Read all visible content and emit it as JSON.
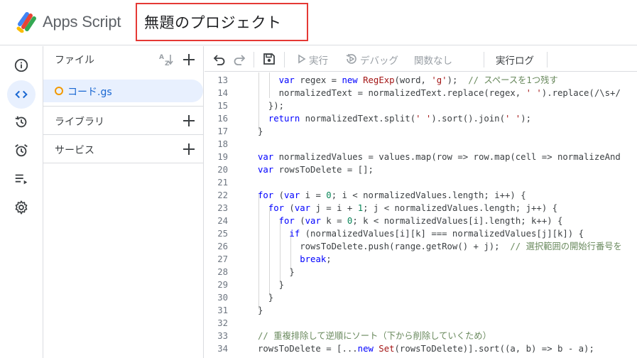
{
  "header": {
    "app_name": "Apps Script",
    "project_title": "無題のプロジェクト"
  },
  "rail": {
    "items": [
      "info-icon",
      "code-icon",
      "history-icon",
      "alarm-icon",
      "executions-icon",
      "settings-icon"
    ],
    "active": "code-icon"
  },
  "files": {
    "label": "ファイル",
    "file_name": "コード.gs",
    "libraries_label": "ライブラリ",
    "services_label": "サービス"
  },
  "toolbar": {
    "run_label": "実行",
    "debug_label": "デバッグ",
    "function_label": "関数なし",
    "log_label": "実行ログ"
  },
  "colors": {
    "accent": "#1967d2",
    "active_bg": "#e8f0fe",
    "highlight_border": "#e53935",
    "file_dot": "#f29900"
  },
  "code": {
    "lines": [
      {
        "n": "13",
        "text": "    var regex = new RegExp(word, 'g');  // スペースを1つ残す"
      },
      {
        "n": "14",
        "text": "    normalizedText = normalizedText.replace(regex, ' ').replace(/\\s+/"
      },
      {
        "n": "15",
        "text": "  });"
      },
      {
        "n": "16",
        "text": "  return normalizedText.split(' ').sort().join(' ');"
      },
      {
        "n": "17",
        "text": "}"
      },
      {
        "n": "18",
        "text": ""
      },
      {
        "n": "19",
        "text": "var normalizedValues = values.map(row => row.map(cell => normalizeAnd"
      },
      {
        "n": "20",
        "text": "var rowsToDelete = [];"
      },
      {
        "n": "21",
        "text": ""
      },
      {
        "n": "22",
        "text": "for (var i = 0; i < normalizedValues.length; i++) {"
      },
      {
        "n": "23",
        "text": "  for (var j = i + 1; j < normalizedValues.length; j++) {"
      },
      {
        "n": "24",
        "text": "    for (var k = 0; k < normalizedValues[i].length; k++) {"
      },
      {
        "n": "25",
        "text": "      if (normalizedValues[i][k] === normalizedValues[j][k]) {"
      },
      {
        "n": "26",
        "text": "        rowsToDelete.push(range.getRow() + j);  // 選択範囲の開始行番号を"
      },
      {
        "n": "27",
        "text": "        break;"
      },
      {
        "n": "28",
        "text": "      }"
      },
      {
        "n": "29",
        "text": "    }"
      },
      {
        "n": "30",
        "text": "  }"
      },
      {
        "n": "31",
        "text": "}"
      },
      {
        "n": "32",
        "text": ""
      },
      {
        "n": "33",
        "text": "// 重複排除して逆順にソート（下から削除していくため）"
      },
      {
        "n": "34",
        "text": "rowsToDelete = [...new Set(rowsToDelete)].sort((a, b) => b - a);"
      }
    ]
  }
}
